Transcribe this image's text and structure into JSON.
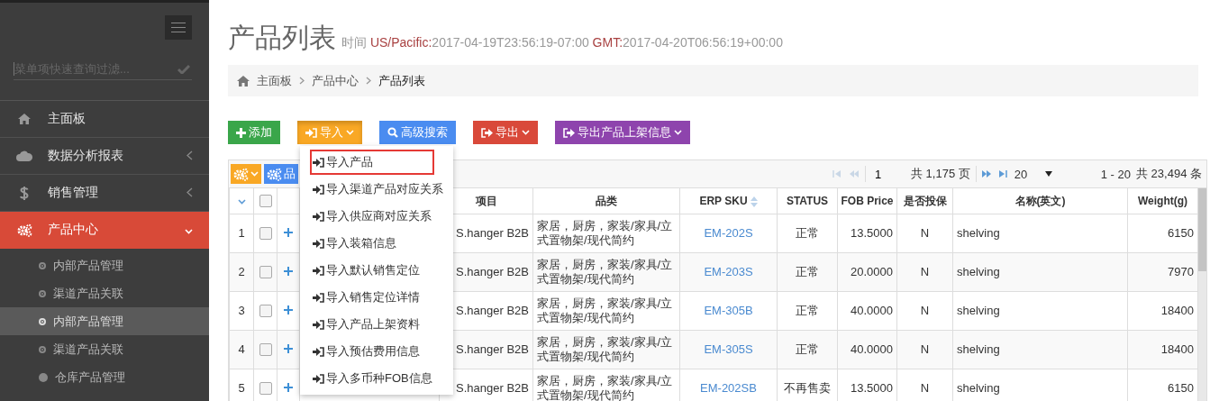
{
  "sidebar": {
    "search": {
      "placeholder": "菜单项快速查询过滤..."
    },
    "items": [
      {
        "label": "主面板",
        "kind": "link",
        "selected": false
      },
      {
        "label": "数据分析报表",
        "kind": "group",
        "selected": false,
        "expanded": false
      },
      {
        "label": "销售管理",
        "kind": "group",
        "selected": false,
        "expanded": false
      },
      {
        "label": "产品中心",
        "kind": "group",
        "selected": true,
        "expanded": true,
        "children": [
          {
            "label": "内部产品管理",
            "kind": "ring",
            "selected": false
          },
          {
            "label": "渠道产品关联",
            "kind": "ring",
            "selected": false
          },
          {
            "label": "内部产品管理",
            "kind": "ring",
            "selected": true
          },
          {
            "label": "渠道产品关联",
            "kind": "ring",
            "selected": false
          },
          {
            "label": "仓库产品管理",
            "kind": "dot",
            "selected": false
          }
        ]
      }
    ]
  },
  "header": {
    "title": "产品列表",
    "label": "时间",
    "zones": [
      {
        "name": "US/Pacific:",
        "time": "2017-04-19T23:56:19-07:00"
      },
      {
        "name": "GMT:",
        "time": "2017-04-20T06:56:19+00:00"
      }
    ]
  },
  "breadcrumb": [
    {
      "label": "主面板",
      "current": false
    },
    {
      "label": "产品中心",
      "current": false
    },
    {
      "label": "产品列表",
      "current": true
    }
  ],
  "toolbar_buttons": [
    {
      "label": "添加",
      "kind": "add",
      "color": "#3aa64a"
    },
    {
      "label": "导入",
      "kind": "import",
      "color": "#f9a825",
      "expanded": true
    },
    {
      "label": "高级搜索",
      "kind": "search",
      "color": "#4a8cf0"
    },
    {
      "label": "导出",
      "kind": "export",
      "color": "#d9493a",
      "expanded": false
    },
    {
      "label": "导出产品上架信息",
      "kind": "export",
      "color": "#8e44ad",
      "expanded": false
    }
  ],
  "import_menu": [
    {
      "label": "导入产品",
      "selected": true
    },
    {
      "label": "导入渠道产品对应关系",
      "selected": false
    },
    {
      "label": "导入供应商对应关系",
      "selected": false
    },
    {
      "label": "导入装箱信息",
      "selected": false
    },
    {
      "label": "导入默认销售定位",
      "selected": false
    },
    {
      "label": "导入销售定位详情",
      "selected": false
    },
    {
      "label": "导入产品上架资料",
      "selected": false
    },
    {
      "label": "导入预估费用信息",
      "selected": false
    },
    {
      "label": "导入多币种FOB信息",
      "selected": false
    }
  ],
  "table": {
    "category_button": "品",
    "pager": {
      "prev_disabled": true,
      "next_disabled": false,
      "page": "1",
      "pages": "共 1,175 页",
      "page_size": "20",
      "range": "1 - 20",
      "total": "共 23,494 条"
    },
    "select_all_checked": false,
    "columns": [
      {
        "label": "项目",
        "kind": "right",
        "sortable": false
      },
      {
        "label": "品类",
        "kind": "text",
        "sortable": false
      },
      {
        "label": "ERP SKU",
        "kind": "link",
        "sortable": true
      },
      {
        "label": "STATUS",
        "kind": "center",
        "sortable": false
      },
      {
        "label": "FOB Price",
        "kind": "number",
        "sortable": false
      },
      {
        "label": "是否投保",
        "kind": "center",
        "sortable": false
      },
      {
        "label": "名称(英文)",
        "kind": "text",
        "sortable": false
      },
      {
        "label": "Weight(g)",
        "kind": "number",
        "sortable": false
      }
    ],
    "rows": [
      {
        "index": "1",
        "checked": false,
        "cells": [
          "S.hanger B2B",
          "家居，厨房，家装/家具/立式置物架/现代简约",
          "EM-202S",
          "正常",
          "13.5000",
          "N",
          "shelving",
          "6150"
        ]
      },
      {
        "index": "2",
        "checked": false,
        "cells": [
          "S.hanger B2B",
          "家居，厨房，家装/家具/立式置物架/现代简约",
          "EM-203S",
          "正常",
          "20.0000",
          "N",
          "shelving",
          "7970"
        ]
      },
      {
        "index": "3",
        "checked": false,
        "cells": [
          "S.hanger B2B",
          "家居，厨房，家装/家具/立式置物架/现代简约",
          "EM-305B",
          "正常",
          "40.0000",
          "N",
          "shelving",
          "18400"
        ]
      },
      {
        "index": "4",
        "checked": false,
        "cells": [
          "S.hanger B2B",
          "家居，厨房，家装/家具/立式置物架/现代简约",
          "EM-305S",
          "正常",
          "40.0000",
          "N",
          "shelving",
          "18400"
        ]
      },
      {
        "index": "5",
        "checked": false,
        "cells": [
          "S.hanger B2B",
          "家居，厨房，家装/家具/立式置物架/现代简约",
          "EM-202SB",
          "不再售卖",
          "13.5000",
          "N",
          "shelving",
          "6150"
        ]
      }
    ]
  }
}
